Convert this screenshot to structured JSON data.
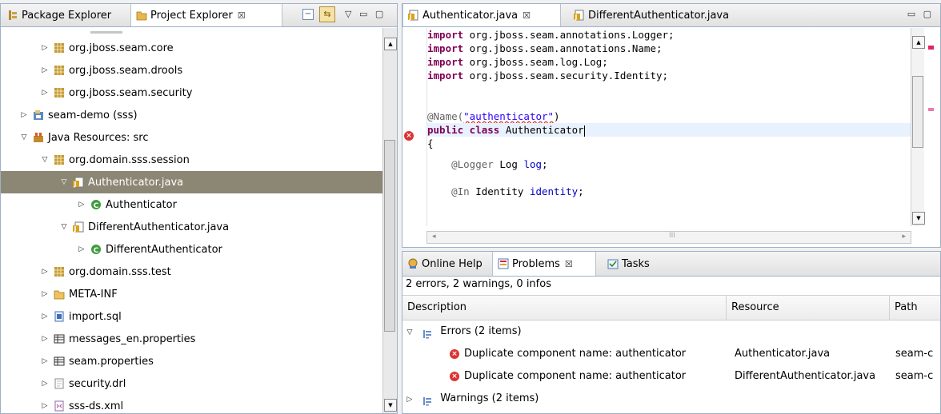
{
  "explorer": {
    "tabs": [
      {
        "label": "Package Explorer"
      },
      {
        "label": "Project Explorer",
        "close": "☒"
      }
    ],
    "window_buttons": "▽ ▭ ▢",
    "tree": [
      {
        "label": "org.jboss.seam.core",
        "toggle": "▷",
        "icon": "package-icon"
      },
      {
        "label": "org.jboss.seam.drools",
        "toggle": "▷",
        "icon": "package-icon"
      },
      {
        "label": "org.jboss.seam.security",
        "toggle": "▷",
        "icon": "package-icon"
      },
      {
        "label": "seam-demo (sss)",
        "toggle": "▷",
        "icon": "project-icon"
      },
      {
        "label": "Java Resources: src",
        "toggle": "▽",
        "icon": "java-resources-icon"
      },
      {
        "label": "org.domain.sss.session",
        "toggle": "▽",
        "icon": "package-icon"
      },
      {
        "label": "Authenticator.java",
        "toggle": "▽",
        "icon": "java-file-icon"
      },
      {
        "label": "Authenticator",
        "toggle": "▷",
        "icon": "class-icon"
      },
      {
        "label": "DifferentAuthenticator.java",
        "toggle": "▽",
        "icon": "java-file-icon"
      },
      {
        "label": "DifferentAuthenticator",
        "toggle": "▷",
        "icon": "class-icon"
      },
      {
        "label": "org.domain.sss.test",
        "toggle": "▷",
        "icon": "package-icon"
      },
      {
        "label": "META-INF",
        "toggle": "▷",
        "icon": "folder-icon"
      },
      {
        "label": "import.sql",
        "toggle": "▷",
        "icon": "sql-file-icon"
      },
      {
        "label": "messages_en.properties",
        "toggle": "▷",
        "icon": "properties-file-icon"
      },
      {
        "label": "seam.properties",
        "toggle": "▷",
        "icon": "properties-file-icon"
      },
      {
        "label": "security.drl",
        "toggle": "▷",
        "icon": "file-icon"
      },
      {
        "label": "sss-ds.xml",
        "toggle": "▷",
        "icon": "xml-file-icon"
      }
    ]
  },
  "editor": {
    "tabs": [
      {
        "label": "Authenticator.java",
        "close": "☒"
      },
      {
        "label": "DifferentAuthenticator.java"
      }
    ],
    "window_buttons": "▭ ▢",
    "lines": [
      {
        "kw": "import",
        "rest": " org.jboss.seam.annotations.Logger;"
      },
      {
        "kw": "import",
        "rest": " org.jboss.seam.annotations.Name;"
      },
      {
        "kw": "import",
        "rest": " org.jboss.seam.log.Log;"
      },
      {
        "kw": "import",
        "rest": " org.jboss.seam.security.Identity;"
      },
      {
        "ann": "@Name(",
        "str": "\"authenticator\"",
        "end": ")"
      },
      {
        "kw": "public class",
        "rest": " Authenticator"
      },
      {
        "rest": "{"
      },
      {
        "ann": "    @Logger",
        "rest": " Log ",
        "fld": "log",
        "end": ";"
      },
      {
        "ann": "    @In",
        "rest": " Identity ",
        "fld": "identity",
        "end": ";"
      }
    ],
    "hscroll_mark": "III"
  },
  "problems": {
    "tabs": [
      {
        "label": "Online Help"
      },
      {
        "label": "Problems",
        "close": "☒"
      },
      {
        "label": "Tasks"
      }
    ],
    "summary": "2 errors, 2 warnings, 0 infos",
    "columns": [
      "Description",
      "Resource",
      "Path"
    ],
    "groups": [
      {
        "toggle": "▽",
        "label": "Errors (2 items)"
      },
      {
        "toggle": "▷",
        "label": "Warnings (2 items)"
      }
    ],
    "errors": [
      {
        "description": "Duplicate component name: authenticator",
        "resource": "Authenticator.java",
        "path": "seam-c"
      },
      {
        "description": "Duplicate component name: authenticator",
        "resource": "DifferentAuthenticator.java",
        "path": "seam-c"
      }
    ]
  }
}
